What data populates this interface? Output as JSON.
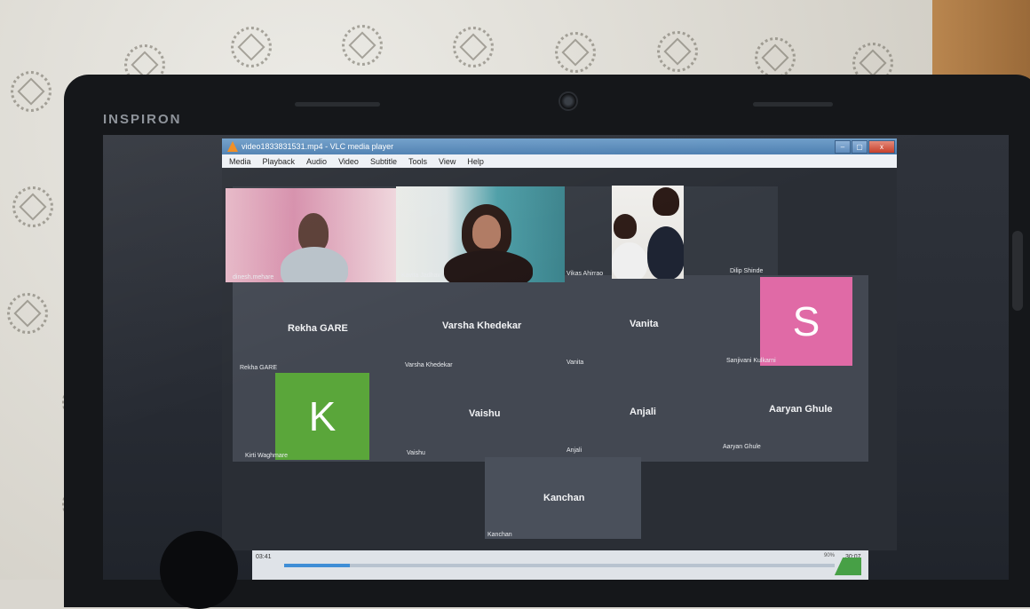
{
  "laptop": {
    "brand": "INSPIRON"
  },
  "window": {
    "title": "video1833831531.mp4 - VLC media player",
    "buttons": [
      "–",
      "▢",
      "x"
    ]
  },
  "menu": [
    "Media",
    "Playback",
    "Audio",
    "Video",
    "Subtitle",
    "Tools",
    "View",
    "Help"
  ],
  "tiles": {
    "dinesh": "dinesh.mehare",
    "kavita": "Kavita Jadhav",
    "vikas": "Vikas Ahirrao",
    "dilip": "Dilip Shinde",
    "rekha_name": "Rekha GARE",
    "rekha_label": "Rekha GARE",
    "varsha_name": "Varsha Khedekar",
    "varsha_label": "Varsha Khedekar",
    "vanita_name": "Vanita",
    "vanita_label": "Vanita",
    "sanjivani_letter": "S",
    "sanjivani_label": "Sanjivani Kulkarni",
    "kirti_letter": "K",
    "kirti_label": "Kirti Waghmare",
    "vaishu_name": "Vaishu",
    "vaishu_label": "Vaishu",
    "anjali_name": "Anjali",
    "anjali_label": "Anjali",
    "aaryan_name": "Aaryan Ghule",
    "aaryan_label": "Aaryan Ghule",
    "kanchan_name": "Kanchan",
    "kanchan_label": "Kanchan"
  },
  "player": {
    "elapsed": "03:41",
    "total": "30:07",
    "volume": "90%",
    "progress_fraction": 0.12
  },
  "colors": {
    "avatar_s": "#e06aa6",
    "avatar_k": "#5aa63a",
    "vlc_titlebar": "#5a8bbf"
  }
}
